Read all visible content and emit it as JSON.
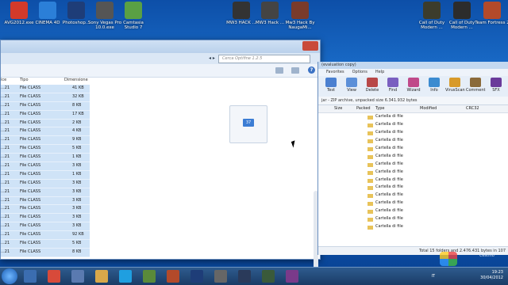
{
  "desktop_icons": [
    {
      "label": "AVG2012.exe",
      "color": "#d33a2a"
    },
    {
      "label": "CINEMA 4D",
      "color": "#2b7fd8"
    },
    {
      "label": "Photoshop...",
      "color": "#1e3d78"
    },
    {
      "label": "Sony Vegas Pro 10.0.exe",
      "color": "#555555"
    },
    {
      "label": "Camtasia Studio 7",
      "color": "#5aa044"
    },
    {
      "label": "MW3 HACK ...",
      "color": "#333333"
    },
    {
      "label": "MW3 Hack ...",
      "color": "#444444"
    },
    {
      "label": "Mw3 Hack By NaugaMi...",
      "color": "#7a3b2b"
    },
    {
      "label": "Call of Duty Modern ...",
      "color": "#3c3c2c"
    },
    {
      "label": "Call of Duty Modern ...",
      "color": "#2c2c2c"
    },
    {
      "label": "Team Fortress 2",
      "color": "#b34a2a"
    }
  ],
  "explorer": {
    "search_placeholder": "Cerca Optifine 1.2.5",
    "columns": {
      "type": "Tipo",
      "size": "Dimensione"
    },
    "rows": [
      {
        "prefix": "...21",
        "type": "File CLASS",
        "size": "41 KB"
      },
      {
        "prefix": "...21",
        "type": "File CLASS",
        "size": "32 KB"
      },
      {
        "prefix": "...21",
        "type": "File CLASS",
        "size": "8 KB"
      },
      {
        "prefix": "...21",
        "type": "File CLASS",
        "size": "17 KB"
      },
      {
        "prefix": "...21",
        "type": "File CLASS",
        "size": "2 KB"
      },
      {
        "prefix": "...21",
        "type": "File CLASS",
        "size": "4 KB"
      },
      {
        "prefix": "...21",
        "type": "File CLASS",
        "size": "9 KB"
      },
      {
        "prefix": "...21",
        "type": "File CLASS",
        "size": "5 KB"
      },
      {
        "prefix": "...21",
        "type": "File CLASS",
        "size": "1 KB"
      },
      {
        "prefix": "...21",
        "type": "File CLASS",
        "size": "3 KB"
      },
      {
        "prefix": "...21",
        "type": "File CLASS",
        "size": "1 KB"
      },
      {
        "prefix": "...21",
        "type": "File CLASS",
        "size": "3 KB"
      },
      {
        "prefix": "...21",
        "type": "File CLASS",
        "size": "3 KB"
      },
      {
        "prefix": "...21",
        "type": "File CLASS",
        "size": "3 KB"
      },
      {
        "prefix": "...21",
        "type": "File CLASS",
        "size": "3 KB"
      },
      {
        "prefix": "...21",
        "type": "File CLASS",
        "size": "3 KB"
      },
      {
        "prefix": "...21",
        "type": "File CLASS",
        "size": "3 KB"
      },
      {
        "prefix": "...21",
        "type": "File CLASS",
        "size": "92 KB"
      },
      {
        "prefix": "...21",
        "type": "File CLASS",
        "size": "5 KB"
      },
      {
        "prefix": "...21",
        "type": "File CLASS",
        "size": "8 KB"
      }
    ],
    "preview_badge": "37"
  },
  "winrar": {
    "title": "(evaluation copy)",
    "menu": [
      "Favorites",
      "Options",
      "Help"
    ],
    "tools": [
      {
        "label": "Test",
        "color": "#4a7fd0"
      },
      {
        "label": "View",
        "color": "#5b8fd8"
      },
      {
        "label": "Delete",
        "color": "#b84848"
      },
      {
        "label": "Find",
        "color": "#7a5fc0"
      },
      {
        "label": "Wizard",
        "color": "#c04a8a"
      },
      {
        "label": "Info",
        "color": "#3b8bd0"
      },
      {
        "label": "VirusScan",
        "color": "#d89a2a"
      },
      {
        "label": "Comment",
        "color": "#8a6a3a"
      },
      {
        "label": "SFX",
        "color": "#6a3a9a"
      }
    ],
    "path": "jar - ZIP archive, unpacked size 6.341.932 bytes",
    "columns": {
      "size": "Size",
      "packed": "Packed",
      "type": "Type",
      "modified": "Modified",
      "crc": "CRC32"
    },
    "folder_type": "Cartella di file",
    "folder_count": 15,
    "status": "Total 15 folders and 2.476.431 bytes in 107"
  },
  "taskbar": {
    "icons": [
      {
        "name": "explorer-icon",
        "color": "#3b6db0"
      },
      {
        "name": "chrome-icon",
        "color": "#d84a3a"
      },
      {
        "name": "media-player-icon",
        "color": "#5a7ab0"
      },
      {
        "name": "folder-icon",
        "color": "#d8a84a"
      },
      {
        "name": "skype-icon",
        "color": "#1f9fe0"
      },
      {
        "name": "minecraft-icon",
        "color": "#5a8a3a"
      },
      {
        "name": "tf2-icon",
        "color": "#b34a2a"
      },
      {
        "name": "photoshop-icon",
        "color": "#1e3d78"
      },
      {
        "name": "app-icon",
        "color": "#666666"
      },
      {
        "name": "steam-icon",
        "color": "#2a3a5a"
      },
      {
        "name": "game-icon",
        "color": "#3a5a3a"
      },
      {
        "name": "winrar-icon",
        "color": "#7a3a8a"
      }
    ],
    "lang": "IT",
    "time": "19:23",
    "date": "30/04/2012"
  },
  "watermark": "Cestino"
}
